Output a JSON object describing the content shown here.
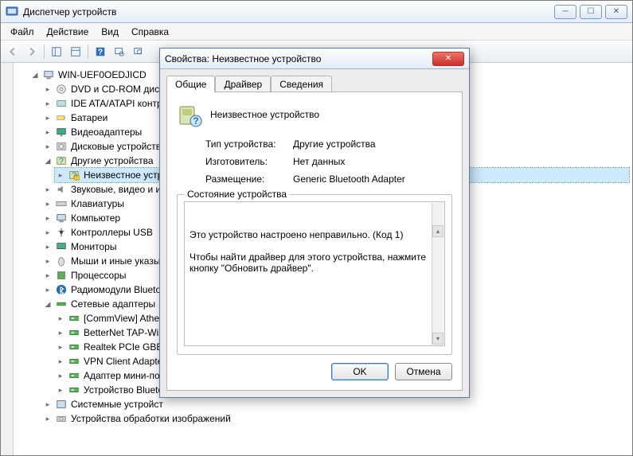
{
  "window": {
    "title": "Диспетчер устройств",
    "menus": [
      "Файл",
      "Действие",
      "Вид",
      "Справка"
    ]
  },
  "tree": {
    "root": "WIN-UEF0OEDJICD",
    "nodes": [
      {
        "label": "DVD и CD-ROM диск",
        "icon": "disc"
      },
      {
        "label": "IDE ATA/ATAPI контр",
        "icon": "ide"
      },
      {
        "label": "Батареи",
        "icon": "battery"
      },
      {
        "label": "Видеоадаптеры",
        "icon": "display"
      },
      {
        "label": "Дисковые устройств",
        "icon": "hdd"
      },
      {
        "label": "Другие устройства",
        "icon": "other",
        "expanded": true,
        "children": [
          {
            "label": "Неизвестное устро",
            "icon": "unknown",
            "warn": true,
            "selected": true
          }
        ]
      },
      {
        "label": "Звуковые, видео и игр",
        "icon": "sound"
      },
      {
        "label": "Клавиатуры",
        "icon": "keyboard"
      },
      {
        "label": "Компьютер",
        "icon": "computer"
      },
      {
        "label": "Контроллеры USB",
        "icon": "usb"
      },
      {
        "label": "Мониторы",
        "icon": "monitor"
      },
      {
        "label": "Мыши и иные указыв",
        "icon": "mouse"
      },
      {
        "label": "Процессоры",
        "icon": "cpu"
      },
      {
        "label": "Радиомодули Blueto",
        "icon": "bluetooth"
      },
      {
        "label": "Сетевые адаптеры",
        "icon": "network",
        "expanded": true,
        "children": [
          {
            "label": "[CommView] Ather",
            "icon": "nic"
          },
          {
            "label": "BetterNet TAP-Win",
            "icon": "nic"
          },
          {
            "label": "Realtek PCIe GBE F",
            "icon": "nic"
          },
          {
            "label": "VPN Client Adapte",
            "icon": "nic"
          },
          {
            "label": "Адаптер мини-по",
            "icon": "nic"
          },
          {
            "label": "Устройство Blueto",
            "icon": "nic"
          }
        ]
      },
      {
        "label": "Системные устройст",
        "icon": "system"
      },
      {
        "label": "Устройства обработки изображений",
        "icon": "imaging"
      }
    ]
  },
  "dialog": {
    "title": "Свойства: Неизвестное устройство",
    "tabs": [
      "Общие",
      "Драйвер",
      "Сведения"
    ],
    "active_tab": 0,
    "device_name": "Неизвестное устройство",
    "props": {
      "type_label": "Тип устройства:",
      "type_value": "Другие устройства",
      "mfg_label": "Изготовитель:",
      "mfg_value": "Нет данных",
      "loc_label": "Размещение:",
      "loc_value": "Generic Bluetooth Adapter"
    },
    "status_label": "Состояние устройства",
    "status_text": "Это устройство настроено неправильно. (Код 1)\n\nЧтобы найти драйвер для этого устройства, нажмите кнопку \"Обновить драйвер\".",
    "ok": "OK",
    "cancel": "Отмена"
  }
}
